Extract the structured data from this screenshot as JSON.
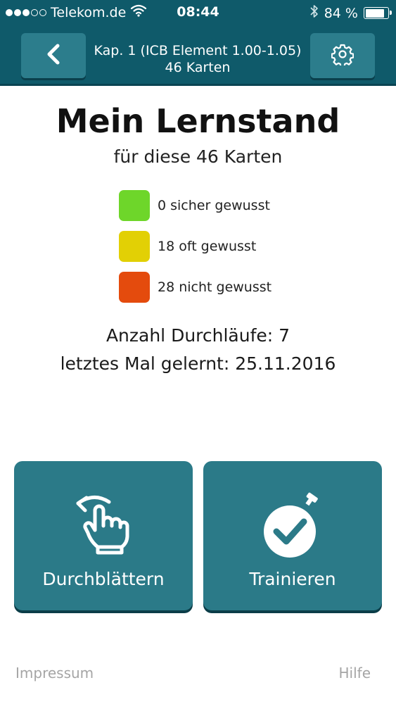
{
  "status_bar": {
    "carrier": "Telekom.de",
    "time": "08:44",
    "battery_text": "84 %",
    "battery_level": 0.84,
    "signal_bars_filled": 3,
    "signal_bars_total": 5
  },
  "header": {
    "title_line1": "Kap. 1 (ICB Element 1.00-1.05)",
    "title_line2": "46 Karten",
    "back_icon": "chevron-left-icon",
    "settings_icon": "gear-icon",
    "background_color": "#0f5a6a"
  },
  "progress": {
    "title": "Mein Lernstand",
    "subtitle": "für diese 46 Karten",
    "legend": [
      {
        "label": "0 sicher gewusst",
        "color": "#6ed62a"
      },
      {
        "label": "18 oft gewusst",
        "color": "#e2d005"
      },
      {
        "label": "28 nicht gewusst",
        "color": "#e44b0d"
      }
    ],
    "runs": "Anzahl Durchläufe: 7",
    "last_learned": "letztes Mal gelernt: 25.11.2016"
  },
  "actions": {
    "browse_label": "Durchblättern",
    "browse_icon": "swipe-hand-icon",
    "train_label": "Trainieren",
    "train_icon": "stopwatch-check-icon",
    "button_color": "#2b7a88"
  },
  "footer": {
    "impressum": "Impressum",
    "help": "Hilfe"
  }
}
